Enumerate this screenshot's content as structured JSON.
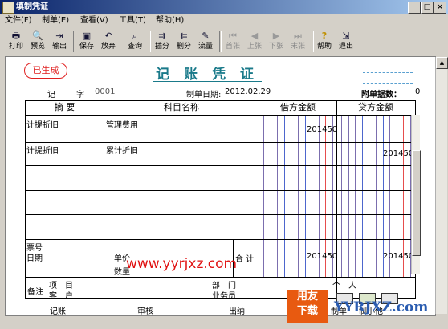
{
  "window": {
    "title": "填制凭证"
  },
  "menu": [
    "文件(F)",
    "制单(E)",
    "查看(V)",
    "工具(T)",
    "帮助(H)"
  ],
  "toolbar": [
    {
      "label": "打印",
      "icon": "print-icon",
      "glyph": "🖶"
    },
    {
      "label": "预览",
      "icon": "preview-icon",
      "glyph": "🔍"
    },
    {
      "label": "输出",
      "icon": "export-icon",
      "glyph": "⇥"
    },
    {
      "label": "保存",
      "icon": "save-icon",
      "glyph": "▣"
    },
    {
      "label": "放弃",
      "icon": "undo-icon",
      "glyph": "↶"
    },
    {
      "label": "查询",
      "icon": "binoculars-icon",
      "glyph": "⌕"
    },
    {
      "label": "插分",
      "icon": "insert-row-icon",
      "glyph": "⇉"
    },
    {
      "label": "删分",
      "icon": "delete-row-icon",
      "glyph": "⇇"
    },
    {
      "label": "流量",
      "icon": "pencil-icon",
      "glyph": "✎"
    },
    {
      "label": "首张",
      "icon": "first-icon",
      "glyph": "⏮",
      "disabled": true
    },
    {
      "label": "上张",
      "icon": "prev-icon",
      "glyph": "◀",
      "disabled": true
    },
    {
      "label": "下张",
      "icon": "next-icon",
      "glyph": "▶",
      "disabled": true
    },
    {
      "label": "末张",
      "icon": "last-icon",
      "glyph": "⏭",
      "disabled": true
    },
    {
      "label": "帮助",
      "icon": "help-icon",
      "glyph": "?"
    },
    {
      "label": "退出",
      "icon": "exit-icon",
      "glyph": "⇲"
    }
  ],
  "voucher": {
    "status": "已生成",
    "title": "记 账 凭 证",
    "type_label": "记",
    "zi_label": "字",
    "number": "0001",
    "date_label": "制单日期:",
    "date": "2012.02.29",
    "attach_label": "附单据数：",
    "attach_count": "0"
  },
  "columns": [
    "摘 要",
    "科目名称",
    "借方金额",
    "贷方金额"
  ],
  "entries": [
    {
      "summary": "计提折旧",
      "account": "管理费用",
      "debit": "201450",
      "credit": ""
    },
    {
      "summary": "计提折旧",
      "account": "累计折旧",
      "debit": "",
      "credit": "201450"
    }
  ],
  "footer_grid": {
    "bill_no_label": "票号",
    "date_label": "日期",
    "price_label": "单价",
    "qty_label": "数量",
    "total_label": "合 计",
    "total_debit": "201450",
    "total_credit": "201450"
  },
  "remarks": {
    "label": "备注",
    "project_label": "项　目",
    "customer_label": "客　户",
    "dept_label": "部　门",
    "person_label": "个　人",
    "clerk_label": "业务员"
  },
  "signatures": [
    "记账",
    "审核",
    "出纳",
    "制单"
  ],
  "signature_tail": "制小他",
  "watermark": "www.yyrjxz.com",
  "logo_text": [
    "用友",
    "下载"
  ],
  "logo_text2": "YYRJXZ.com"
}
